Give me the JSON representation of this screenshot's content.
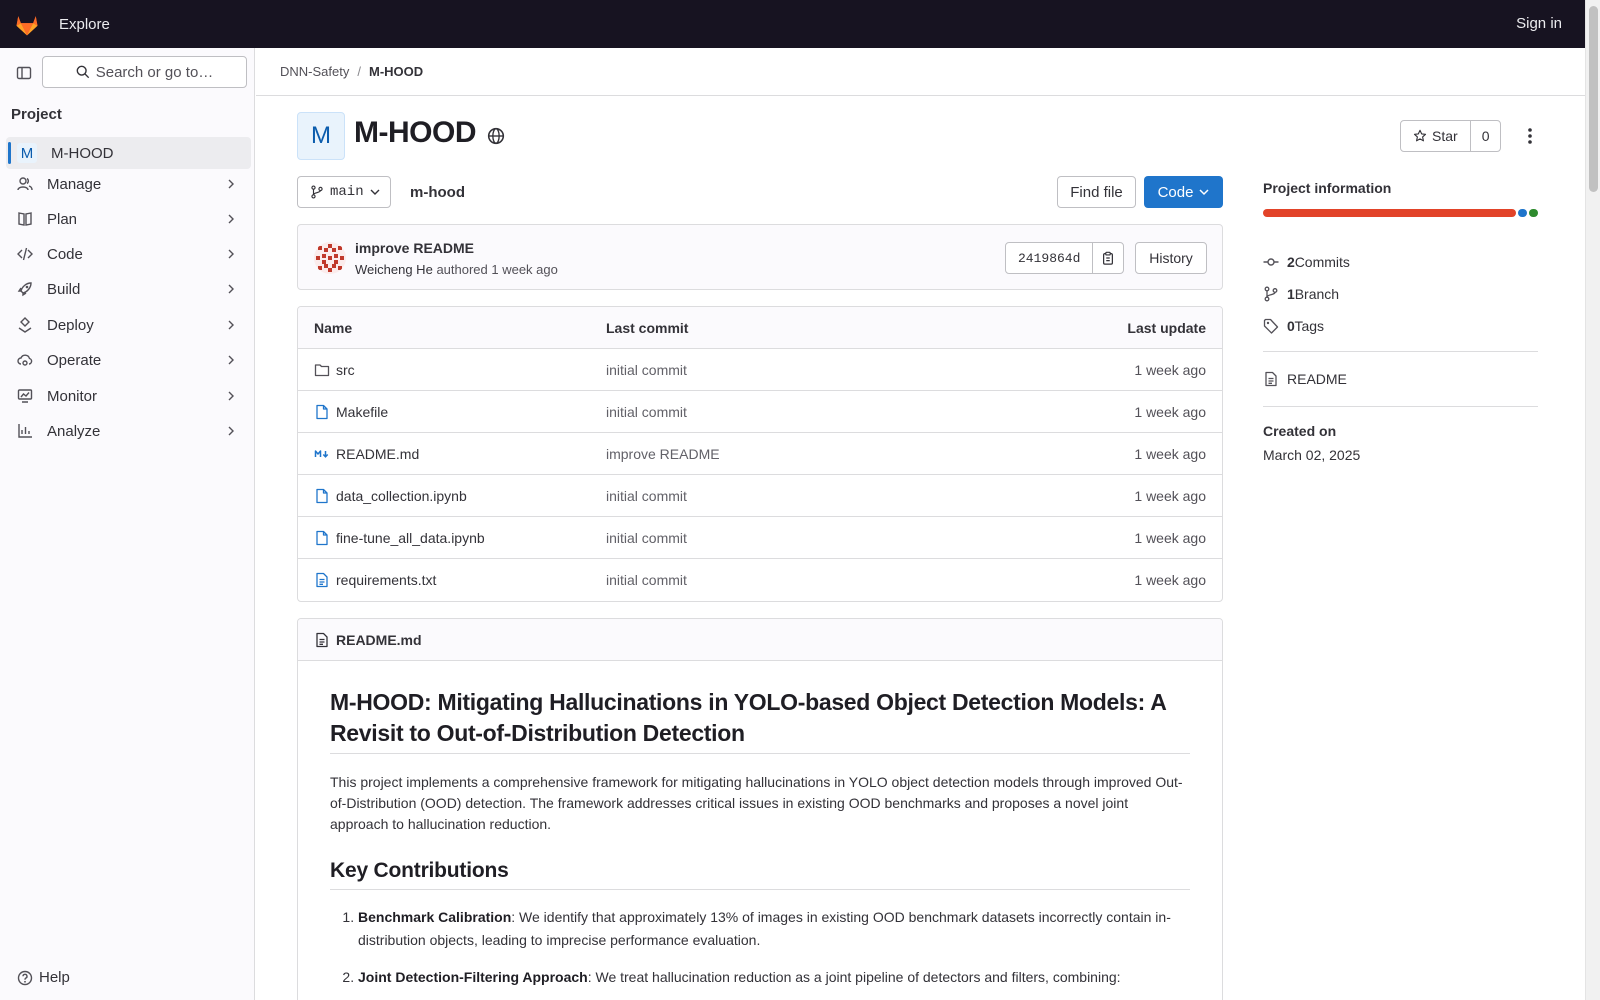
{
  "topbar": {
    "explore_label": "Explore",
    "signin_label": "Sign in"
  },
  "sidebar": {
    "search_placeholder": "Search or go to…",
    "heading": "Project",
    "current_project": {
      "avatar_letter": "M",
      "label": "M-HOOD"
    },
    "items": [
      {
        "label": "Manage",
        "icon": "users-icon"
      },
      {
        "label": "Plan",
        "icon": "book-icon"
      },
      {
        "label": "Code",
        "icon": "code-icon"
      },
      {
        "label": "Build",
        "icon": "rocket-icon"
      },
      {
        "label": "Deploy",
        "icon": "deploy-icon"
      },
      {
        "label": "Operate",
        "icon": "cloud-gear-icon"
      },
      {
        "label": "Monitor",
        "icon": "monitor-icon"
      },
      {
        "label": "Analyze",
        "icon": "chart-icon"
      }
    ],
    "help_label": "Help"
  },
  "breadcrumb": {
    "group": "DNN-Safety",
    "project": "M-HOOD"
  },
  "project": {
    "avatar_letter": "M",
    "title": "M-HOOD",
    "star_label": "Star",
    "star_count": "0"
  },
  "repo": {
    "branch": "main",
    "path": "m-hood",
    "find_file_label": "Find file",
    "code_label": "Code"
  },
  "last_commit": {
    "message": "improve README",
    "author": "Weicheng He",
    "authored_text": "authored 1 week ago",
    "sha": "2419864d",
    "history_label": "History"
  },
  "files": {
    "headers": {
      "name": "Name",
      "last_commit": "Last commit",
      "last_update": "Last update"
    },
    "rows": [
      {
        "name": "src",
        "type": "folder",
        "commit": "initial commit",
        "updated": "1 week ago"
      },
      {
        "name": "Makefile",
        "type": "file",
        "commit": "initial commit",
        "updated": "1 week ago"
      },
      {
        "name": "README.md",
        "type": "markdown",
        "commit": "improve README",
        "updated": "1 week ago"
      },
      {
        "name": "data_collection.ipynb",
        "type": "file",
        "commit": "initial commit",
        "updated": "1 week ago"
      },
      {
        "name": "fine-tune_all_data.ipynb",
        "type": "file",
        "commit": "initial commit",
        "updated": "1 week ago"
      },
      {
        "name": "requirements.txt",
        "type": "text",
        "commit": "initial commit",
        "updated": "1 week ago"
      }
    ]
  },
  "readme": {
    "filename": "README.md",
    "title": "M-HOOD: Mitigating Hallucinations in YOLO-based Object Detection Models: A Revisit to Out-of-Distribution Detection",
    "intro": "This project implements a comprehensive framework for mitigating hallucinations in YOLO object detection models through improved Out-of-Distribution (OOD) detection. The framework addresses critical issues in existing OOD benchmarks and proposes a novel joint approach to hallucination reduction.",
    "contributions_heading": "Key Contributions",
    "contributions": [
      {
        "title": "Benchmark Calibration",
        "text": ": We identify that approximately 13% of images in existing OOD benchmark datasets incorrectly contain in-distribution objects, leading to imprecise performance evaluation."
      },
      {
        "title": "Joint Detection-Filtering Approach",
        "text": ": We treat hallucination reduction as a joint pipeline of detectors and filters, combining:"
      }
    ]
  },
  "project_info": {
    "title": "Project information",
    "languages": [
      {
        "color": "#e24329",
        "share": 0.934
      },
      {
        "color": "#1f75cb",
        "share": 0.033
      },
      {
        "color": "#2e8b2e",
        "share": 0.033
      }
    ],
    "commits_count": "2",
    "commits_label": "Commits",
    "branch_count": "1",
    "branch_label": "Branch",
    "tags_count": "0",
    "tags_label": "Tags",
    "readme_label": "README",
    "created_label": "Created on",
    "created_date": "March 02, 2025"
  }
}
